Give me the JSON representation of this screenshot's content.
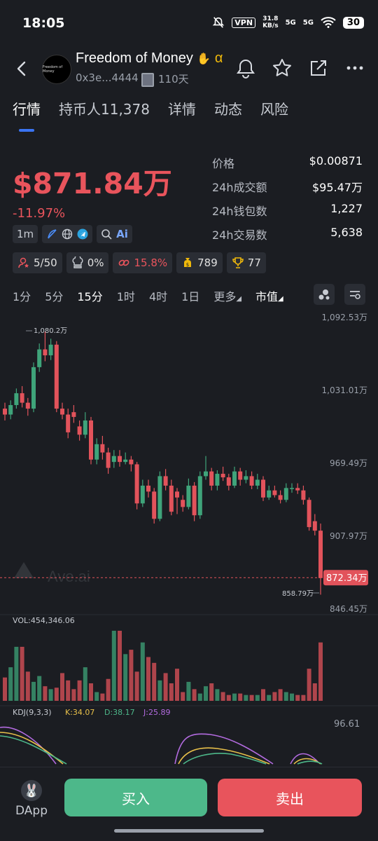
{
  "status": {
    "time": "18:05",
    "vpn": "VPN",
    "net_speed": "31.8",
    "net_unit": "KB/s",
    "sig1": "5G",
    "sig2": "5G",
    "battery": "30"
  },
  "token": {
    "name": "Freedom of Money",
    "logo_text": "Freedom of Money",
    "address": "0x3e...4444",
    "age": "110天"
  },
  "tabs": [
    {
      "label": "行情"
    },
    {
      "label": "持币人11,378"
    },
    {
      "label": "详情"
    },
    {
      "label": "动态"
    },
    {
      "label": "风险"
    }
  ],
  "price": {
    "market_cap": "$871.84万",
    "change": "-11.97%"
  },
  "stats": [
    {
      "key": "价格",
      "value": "$0.00871"
    },
    {
      "key": "24h成交额",
      "value": "$95.47万"
    },
    {
      "key": "24h钱包数",
      "value": "1,227"
    },
    {
      "key": "24h交易数",
      "value": "5,638"
    }
  ],
  "badges": {
    "age": "1m"
  },
  "chips": [
    {
      "icon": "user-alert-icon",
      "text": "5/50",
      "color": "#e0e0e0"
    },
    {
      "icon": "chef-hat-icon",
      "text": "0%",
      "color": "#e0e0e0"
    },
    {
      "icon": "link-icon",
      "text": "15.8%",
      "color": "#e9545c"
    },
    {
      "icon": "money-bag-icon",
      "text": "789",
      "color": "#e0e0e0"
    },
    {
      "icon": "trophy-icon",
      "text": "77",
      "color": "#e0e0e0"
    }
  ],
  "intervals": [
    "1分",
    "5分",
    "15分",
    "1时",
    "4时",
    "1日",
    "更多",
    "市值"
  ],
  "selected_interval": "15分",
  "chart_data": {
    "type": "candlestick",
    "y_axis_labels": [
      "1,092.53万",
      "1,031.01万",
      "969.49万",
      "907.97万",
      "846.45万"
    ],
    "ylim": [
      846.45,
      1092.53
    ],
    "current_price_label": "872.34万",
    "high_label": "1,080.2万",
    "low_label": "858.79万",
    "watermark": "Ave.ai",
    "volume_label": "VOL:454,346.06",
    "kdj": {
      "label": "KDJ(9,3,3)",
      "k": "K:34.07",
      "d": "D:38.17",
      "j": "J:25.89",
      "top_value": "96.61"
    },
    "candles": [
      [
        0,
        1015,
        1010,
        1020,
        1005
      ],
      [
        1,
        1010,
        1018,
        1022,
        1006
      ],
      [
        2,
        1018,
        1028,
        1032,
        1015
      ],
      [
        3,
        1028,
        1020,
        1034,
        1016
      ],
      [
        4,
        1020,
        1015,
        1024,
        1009
      ],
      [
        5,
        1015,
        1050,
        1054,
        1012
      ],
      [
        6,
        1050,
        1065,
        1070,
        1046
      ],
      [
        7,
        1065,
        1060,
        1080,
        1055
      ],
      [
        8,
        1060,
        1069,
        1074,
        1056
      ],
      [
        9,
        1069,
        1015,
        1072,
        1012
      ],
      [
        10,
        1015,
        1010,
        1020,
        1006
      ],
      [
        11,
        1010,
        995,
        1015,
        990
      ],
      [
        12,
        1012,
        1008,
        1018,
        1003
      ],
      [
        13,
        1000,
        993,
        1005,
        988
      ],
      [
        14,
        993,
        1005,
        1012,
        990
      ],
      [
        15,
        1005,
        972,
        1008,
        968
      ],
      [
        16,
        972,
        985,
        990,
        968
      ],
      [
        17,
        985,
        978,
        992,
        972
      ],
      [
        18,
        978,
        965,
        982,
        960
      ],
      [
        19,
        970,
        975,
        980,
        965
      ],
      [
        20,
        975,
        970,
        980,
        966
      ],
      [
        21,
        970,
        972,
        978,
        968
      ],
      [
        22,
        972,
        968,
        975,
        962
      ],
      [
        23,
        968,
        935,
        970,
        930
      ],
      [
        24,
        935,
        950,
        955,
        932
      ],
      [
        25,
        950,
        945,
        955,
        940
      ],
      [
        26,
        945,
        922,
        948,
        918
      ],
      [
        27,
        922,
        958,
        962,
        920
      ],
      [
        28,
        958,
        950,
        964,
        946
      ],
      [
        29,
        950,
        928,
        955,
        925
      ],
      [
        30,
        945,
        940,
        948,
        926
      ],
      [
        31,
        938,
        932,
        942,
        928
      ],
      [
        32,
        932,
        950,
        956,
        930
      ],
      [
        33,
        950,
        925,
        953,
        920
      ],
      [
        34,
        925,
        958,
        962,
        922
      ],
      [
        35,
        958,
        962,
        975,
        955
      ],
      [
        36,
        962,
        950,
        965,
        946
      ],
      [
        37,
        950,
        960,
        963,
        946
      ],
      [
        38,
        960,
        957,
        966,
        954
      ],
      [
        39,
        957,
        950,
        960,
        946
      ],
      [
        40,
        950,
        962,
        966,
        948
      ],
      [
        41,
        962,
        955,
        965,
        950
      ],
      [
        42,
        955,
        958,
        963,
        952
      ],
      [
        43,
        958,
        950,
        962,
        947
      ],
      [
        44,
        950,
        955,
        960,
        947
      ],
      [
        45,
        955,
        940,
        958,
        937
      ],
      [
        46,
        940,
        946,
        950,
        938
      ],
      [
        47,
        946,
        942,
        950,
        940
      ],
      [
        48,
        942,
        938,
        946,
        935
      ],
      [
        49,
        938,
        948,
        952,
        936
      ],
      [
        50,
        948,
        948,
        952,
        944
      ],
      [
        51,
        948,
        946,
        952,
        943
      ],
      [
        52,
        946,
        938,
        950,
        934
      ],
      [
        53,
        938,
        915,
        940,
        912
      ],
      [
        54,
        920,
        912,
        926,
        908
      ],
      [
        55,
        912,
        872,
        918,
        858
      ]
    ],
    "volumes": [
      16,
      23,
      37,
      37,
      20,
      13,
      17,
      10,
      8,
      9,
      19,
      14,
      8,
      14,
      23,
      12,
      6,
      5,
      15,
      48,
      48,
      32,
      35,
      20,
      40,
      30,
      26,
      14,
      19,
      12,
      22,
      6,
      13,
      8,
      5,
      10,
      12,
      8,
      6,
      4,
      5,
      5,
      4,
      4,
      4,
      8,
      4,
      6,
      8,
      6,
      5,
      4,
      4,
      22,
      12,
      40
    ]
  },
  "bottom": {
    "dapp": "DApp",
    "buy": "买入",
    "sell": "卖出"
  },
  "colors": {
    "up": "#3fa47a",
    "down": "#e2535b",
    "accent": "#3a74f2",
    "bg": "#1b1d22"
  }
}
